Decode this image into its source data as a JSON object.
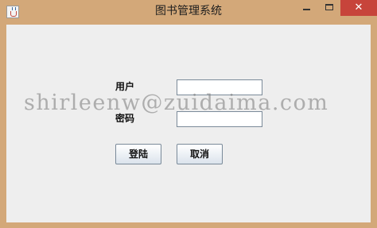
{
  "window": {
    "title": "图书管理系统",
    "close_glyph": "✕",
    "app_icon": "java-cup-icon",
    "colors": {
      "frame": "#d3a879",
      "close_button": "#c7443b",
      "client": "#eeeeee"
    }
  },
  "form": {
    "username_label": "用户",
    "username_value": "",
    "password_label": "密码",
    "password_value": "",
    "login_button": "登陆",
    "cancel_button": "取消"
  },
  "watermark": "shirleenw@zuidaima.com"
}
